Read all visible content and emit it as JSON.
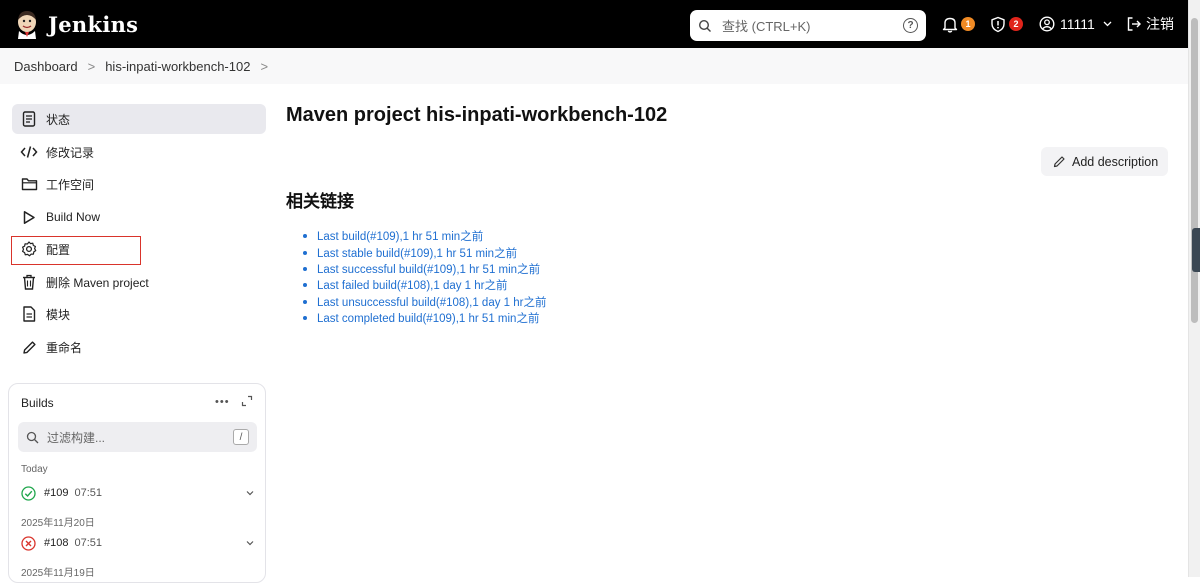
{
  "header": {
    "brand": "Jenkins",
    "search_placeholder": "查找 (CTRL+K)",
    "help_glyph": "?",
    "notifications_count": "1",
    "security_count": "2",
    "user": "11111",
    "logout": "注销",
    "colors": {
      "bar": "#000000",
      "notif_badge": "#f08a24",
      "security_badge": "#e0241b"
    }
  },
  "breadcrumb": {
    "items": [
      "Dashboard",
      "his-inpati-workbench-102"
    ],
    "sep": ">"
  },
  "sidebar": {
    "tasks": [
      {
        "label": "状态",
        "icon": "document-icon",
        "active": true
      },
      {
        "label": "修改记录",
        "icon": "code-icon"
      },
      {
        "label": "工作空间",
        "icon": "folder-icon"
      },
      {
        "label": "Build Now",
        "icon": "play-icon"
      },
      {
        "label": "配置",
        "icon": "gear-icon"
      },
      {
        "label": "删除 Maven project",
        "icon": "trash-icon"
      },
      {
        "label": "模块",
        "icon": "file-icon"
      },
      {
        "label": "重命名",
        "icon": "pencil-icon"
      }
    ]
  },
  "builds": {
    "title": "Builds",
    "more": "•••",
    "filter_placeholder": "过滤构建...",
    "filter_key": "/",
    "groups": [
      {
        "label": "Today",
        "items": [
          {
            "id": "#109",
            "time": "07:51",
            "status": "success"
          }
        ]
      },
      {
        "label": "2025年11月20日",
        "items": [
          {
            "id": "#108",
            "time": "07:51",
            "status": "failed"
          }
        ]
      },
      {
        "label": "2025年11月19日",
        "items": []
      }
    ],
    "colors": {
      "success": "#1ea64b",
      "failed": "#d9342b"
    }
  },
  "main": {
    "title": "Maven project his-inpati-workbench-102",
    "add_description": "Add description",
    "section_title": "相关链接",
    "links": [
      "Last build(#109),1 hr 51 min之前",
      "Last stable build(#109),1 hr 51 min之前",
      "Last successful build(#109),1 hr 51 min之前",
      "Last failed build(#108),1 day 1 hr之前",
      "Last unsuccessful build(#108),1 day 1 hr之前",
      "Last completed build(#109),1 hr 51 min之前"
    ],
    "link_color": "#1f6fd1"
  }
}
